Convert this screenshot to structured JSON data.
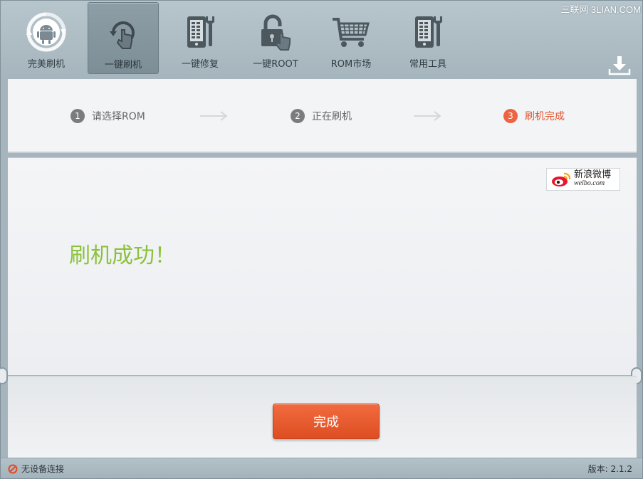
{
  "watermark": "三联网 3LIAN.COM",
  "toolbar": {
    "items": [
      {
        "label": "完美刷机",
        "icon": "android-refresh-icon",
        "active": false
      },
      {
        "label": "一键刷机",
        "icon": "refresh-hand-icon",
        "active": true
      },
      {
        "label": "一键修复",
        "icon": "phone-wrench-icon",
        "active": false
      },
      {
        "label": "一键ROOT",
        "icon": "lock-hand-icon",
        "active": false
      },
      {
        "label": "ROM市场",
        "icon": "shopping-cart-icon",
        "active": false
      },
      {
        "label": "常用工具",
        "icon": "phone-tools-icon",
        "active": false
      }
    ],
    "download_icon": "download-icon"
  },
  "steps": [
    {
      "num": "1",
      "label": "请选择ROM",
      "state": "normal"
    },
    {
      "num": "2",
      "label": "正在刷机",
      "state": "normal"
    },
    {
      "num": "3",
      "label": "刷机完成",
      "state": "done"
    }
  ],
  "weibo": {
    "name": "新浪微博",
    "domain": "weibo.com"
  },
  "message": "刷机成功！",
  "finish_button": "完成",
  "status": {
    "connection": "无设备连接",
    "version": "版本: 2.1.2"
  },
  "colors": {
    "accent": "#ee6341",
    "success": "#8cc13d",
    "button": "#e85a2e"
  }
}
